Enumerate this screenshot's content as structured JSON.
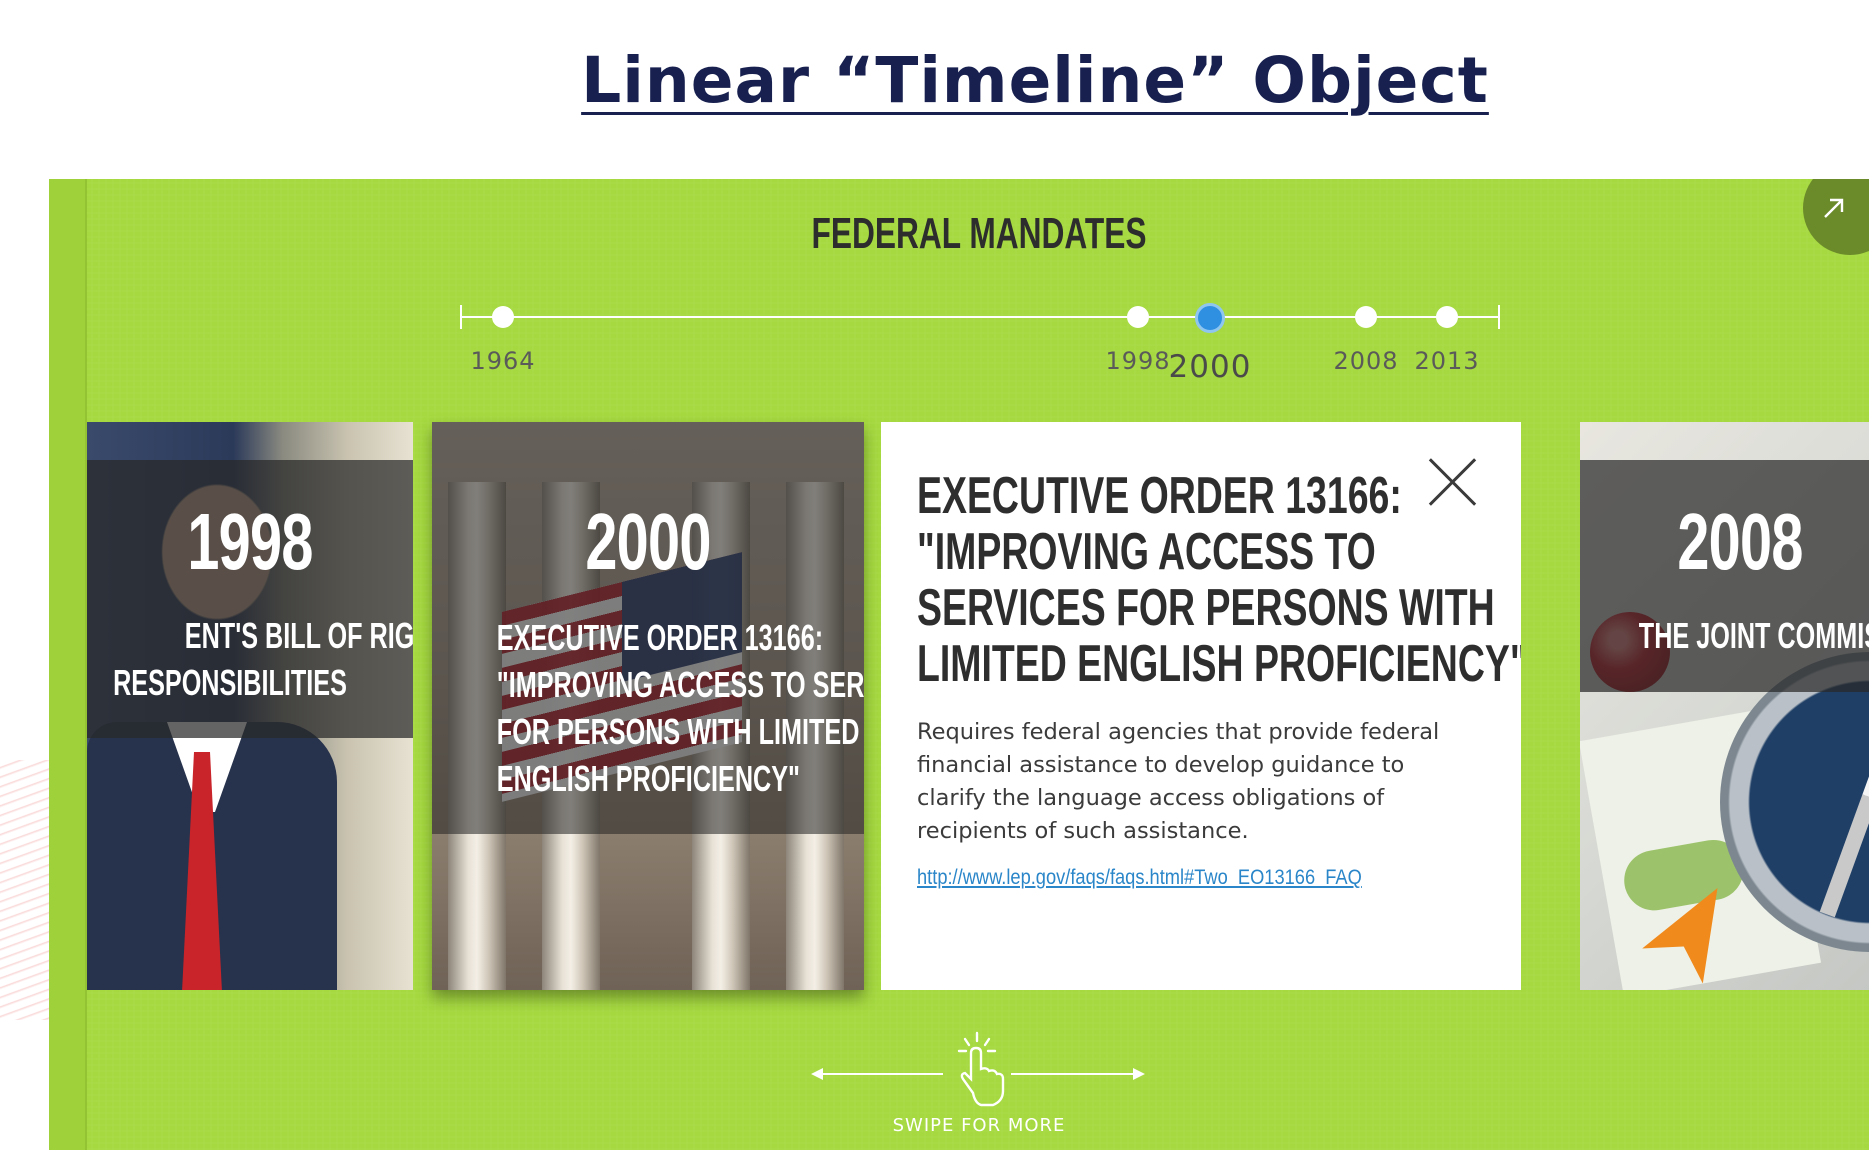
{
  "slide": {
    "title": "Linear “Timeline” Object"
  },
  "widget": {
    "heading": "FEDERAL MANDATES",
    "accent_color": "#a5d93f",
    "active_color": "#2f8fe0",
    "timeline": {
      "years": [
        "1964",
        "1998",
        "2000",
        "2008",
        "2013"
      ],
      "active_year": "2000"
    },
    "cards": [
      {
        "year": "1998",
        "lines": [
          "ENT'S BILL OF RIGHTS AND",
          "RESPONSIBILITIES"
        ]
      },
      {
        "year": "2000",
        "lines": [
          "EXECUTIVE ORDER 13166:",
          "\"IMPROVING ACCESS TO SERVICES",
          "FOR PERSONS WITH LIMITED",
          "ENGLISH PROFICIENCY\""
        ]
      },
      {
        "year": "2008",
        "lines": [
          "THE JOINT COMMISSIO"
        ]
      }
    ],
    "detail": {
      "title_lines": [
        "EXECUTIVE ORDER 13166:",
        "\"IMPROVING ACCESS TO",
        "SERVICES FOR PERSONS WITH",
        "LIMITED ENGLISH PROFICIENCY\""
      ],
      "body": "Requires federal agencies that provide federal financial assistance to develop guidance to clarify the language access obligations of recipients of such assistance.",
      "link": "http://www.lep.gov/faqs/faqs.html#Two_EO13166_FAQ"
    },
    "swipe_label": "SWIPE FOR MORE",
    "icons": {
      "corner": "expand-arrow-icon",
      "close": "close-icon",
      "swipe": "swipe-hand-icon"
    }
  }
}
